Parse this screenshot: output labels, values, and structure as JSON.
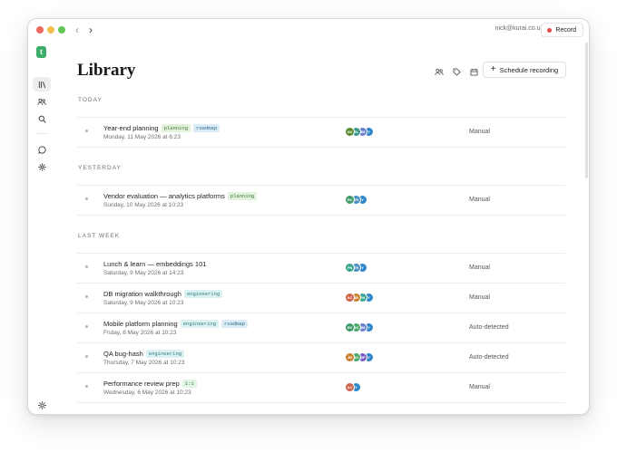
{
  "window": {
    "user_email": "nick@kurai.co.uk",
    "record_label": "Record"
  },
  "sidebar": {
    "logo_letter": "t",
    "items": [
      {
        "icon": "library-icon",
        "active": true
      },
      {
        "icon": "people-icon",
        "active": false
      },
      {
        "icon": "search-icon",
        "active": false
      },
      {
        "icon": "chat-icon",
        "active": false
      },
      {
        "icon": "gear-icon",
        "active": false
      }
    ],
    "bottom_icon": "sun-icon"
  },
  "header": {
    "title": "Library",
    "schedule_label": "Schedule recording"
  },
  "sections": [
    {
      "label": "TODAY",
      "meetings": [
        {
          "title": "Year-end planning",
          "tags": [
            "planning",
            "roadmap"
          ],
          "date": "Monday, 11 May 2026 at 6:23",
          "avatars": [
            "DK",
            "EL",
            "JM",
            "Y"
          ],
          "source": "Manual"
        }
      ]
    },
    {
      "label": "YESTERDAY",
      "meetings": [
        {
          "title": "Vendor evaluation — analytics platforms",
          "tags": [
            "planning"
          ],
          "date": "Sunday, 10 May 2026 at 10:23",
          "avatars": [
            "EK",
            "TR",
            "Y"
          ],
          "source": "Manual"
        }
      ]
    },
    {
      "label": "LAST WEEK",
      "meetings": [
        {
          "title": "Lunch & learn — embeddings 101",
          "tags": [],
          "date": "Saturday, 9 May 2026 at 14:23",
          "avatars": [
            "PN",
            "TR",
            "Y"
          ],
          "source": "Manual"
        },
        {
          "title": "DB migration walkthrough",
          "tags": [
            "engineering"
          ],
          "date": "Saturday, 9 May 2026 at 10:23",
          "avatars": [
            "AC",
            "JB",
            "PN",
            "Y"
          ],
          "source": "Manual"
        },
        {
          "title": "Mobile platform planning",
          "tags": [
            "engineering",
            "roadmap"
          ],
          "date": "Friday, 8 May 2026 at 10:23",
          "avatars": [
            "EK",
            "SG",
            "JM",
            "Y"
          ],
          "source": "Auto-detected"
        },
        {
          "title": "QA bug-hash",
          "tags": [
            "engineering"
          ],
          "date": "Thursday, 7 May 2026 at 10:23",
          "avatars": [
            "JB",
            "SG",
            "MP",
            "Y"
          ],
          "source": "Auto-detected"
        },
        {
          "title": "Performance review prep",
          "tags": [
            "1:1"
          ],
          "date": "Wednesday, 6 May 2026 at 10:23",
          "avatars": [
            "AC",
            "Y"
          ],
          "source": "Manual"
        }
      ]
    }
  ],
  "colors": {
    "accent_green": "#3dae6a",
    "record_red": "#e5484d",
    "avatar_palette": {
      "DK": "#5b8a2f",
      "EL": "#3b9a8c",
      "JM": "#6a7fd1",
      "Y": "#2f86c9",
      "EK": "#3f9a67",
      "TR": "#4a90c2",
      "PN": "#3aa58f",
      "AC": "#d0634b",
      "JB": "#c9812b",
      "SG": "#4aa86b",
      "MP": "#7b5fc9"
    }
  }
}
